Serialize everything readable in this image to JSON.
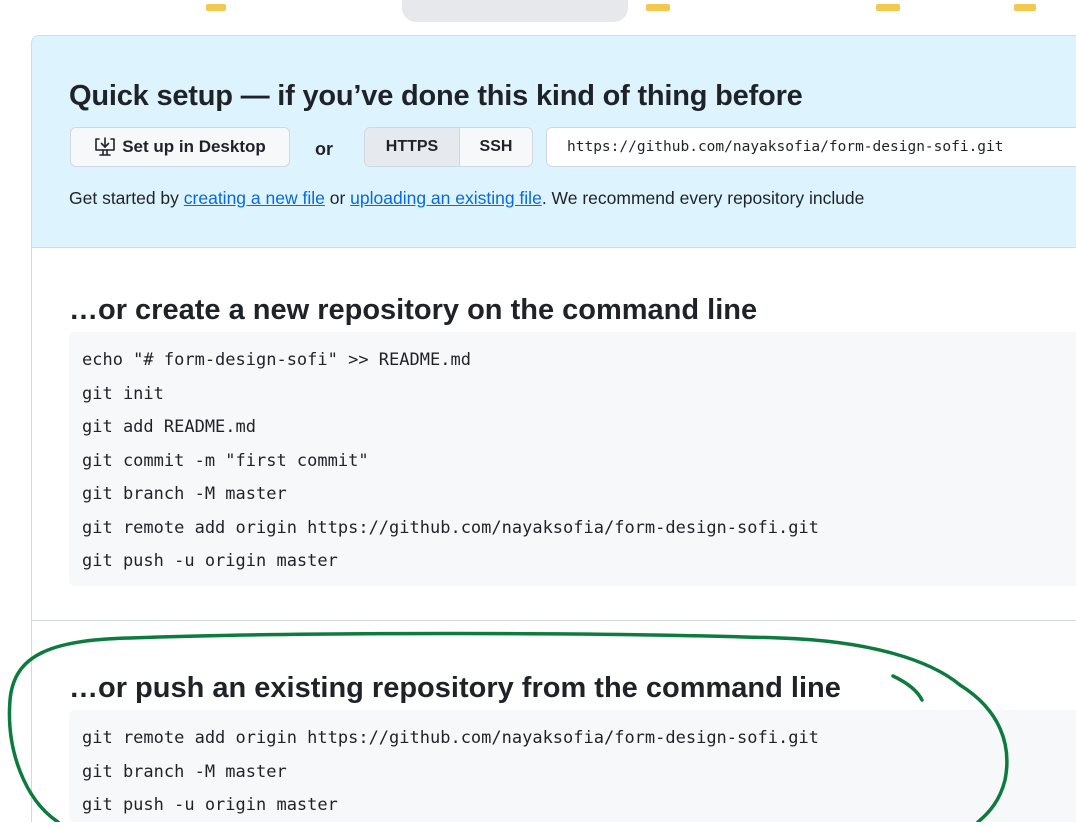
{
  "quick_setup": {
    "title": "Quick setup — if you’ve done this kind of thing before",
    "desktop_button": "Set up in Desktop",
    "or": "or",
    "protocols": [
      "HTTPS",
      "SSH"
    ],
    "selected_protocol": "HTTPS",
    "clone_url": "https://github.com/nayaksofia/form-design-sofi.git",
    "get_started": {
      "prefix": "Get started by ",
      "link1": "creating a new file",
      "middle": " or ",
      "link2": "uploading an existing file",
      "suffix": ". We recommend every repository include"
    }
  },
  "new_repo": {
    "title": "…or create a new repository on the command line",
    "lines": [
      "echo \"# form-design-sofi\" >> README.md",
      "git init",
      "git add README.md",
      "git commit -m \"first commit\"",
      "git branch -M master",
      "git remote add origin https://github.com/nayaksofia/form-design-sofi.git",
      "git push -u origin master"
    ]
  },
  "existing_repo": {
    "title": "…or push an existing repository from the command line",
    "lines": [
      "git remote add origin https://github.com/nayaksofia/form-design-sofi.git",
      "git branch -M master",
      "git push -u origin master"
    ]
  },
  "colors": {
    "panel_bg": "#ddf4ff",
    "link": "#0969da",
    "code_bg": "#f6f8fa",
    "annotation": "#0e7b3e"
  },
  "icons": {
    "desktop_button_icon": "desktop-download-icon"
  }
}
